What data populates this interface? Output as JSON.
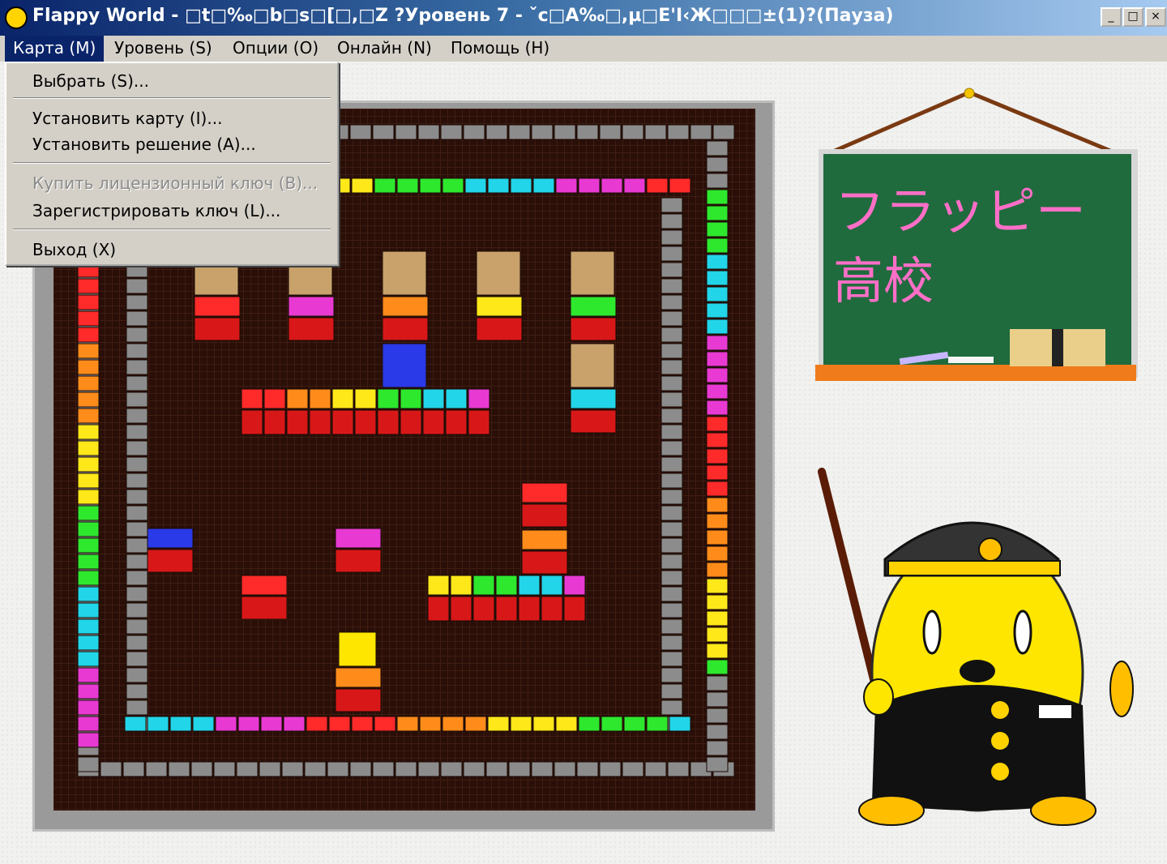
{
  "window": {
    "title": "Flappy World - □t□‰□b□s□[□,□Z ?Уровень 7 - ˇc□A‰□,µ□E'I‹Ж□□□±(1)?(Пауза)",
    "minimize_label": "_",
    "maximize_label": "□",
    "close_label": "×"
  },
  "menubar": {
    "items": [
      {
        "label": "Карта (M)"
      },
      {
        "label": "Уровень (S)"
      },
      {
        "label": "Опции (O)"
      },
      {
        "label": "Онлайн (N)"
      },
      {
        "label": "Помощь (H)"
      }
    ]
  },
  "dropdown": {
    "items": [
      {
        "label": "Выбрать (S)...",
        "enabled": true
      },
      {
        "label": "Установить карту (I)...",
        "enabled": true
      },
      {
        "label": "Установить решение (A)...",
        "enabled": true
      },
      {
        "label": "Купить лицензионный ключ (B)...",
        "enabled": false
      },
      {
        "label": "Зарегистрировать ключ (L)...",
        "enabled": true
      },
      {
        "label": "Выход (X)",
        "enabled": true
      }
    ]
  },
  "chalkboard": {
    "line1": "フラッピー",
    "line2": "高校"
  },
  "colors": {
    "titlebar_start": "#0a246a",
    "menu_highlight": "#0a246a",
    "chalkboard": "#1f6b3d",
    "chalk_pink": "#ff6ec7",
    "mascot_yellow": "#ffe600"
  },
  "icons": [
    "app-icon",
    "minimize-icon",
    "maximize-icon",
    "close-icon"
  ]
}
